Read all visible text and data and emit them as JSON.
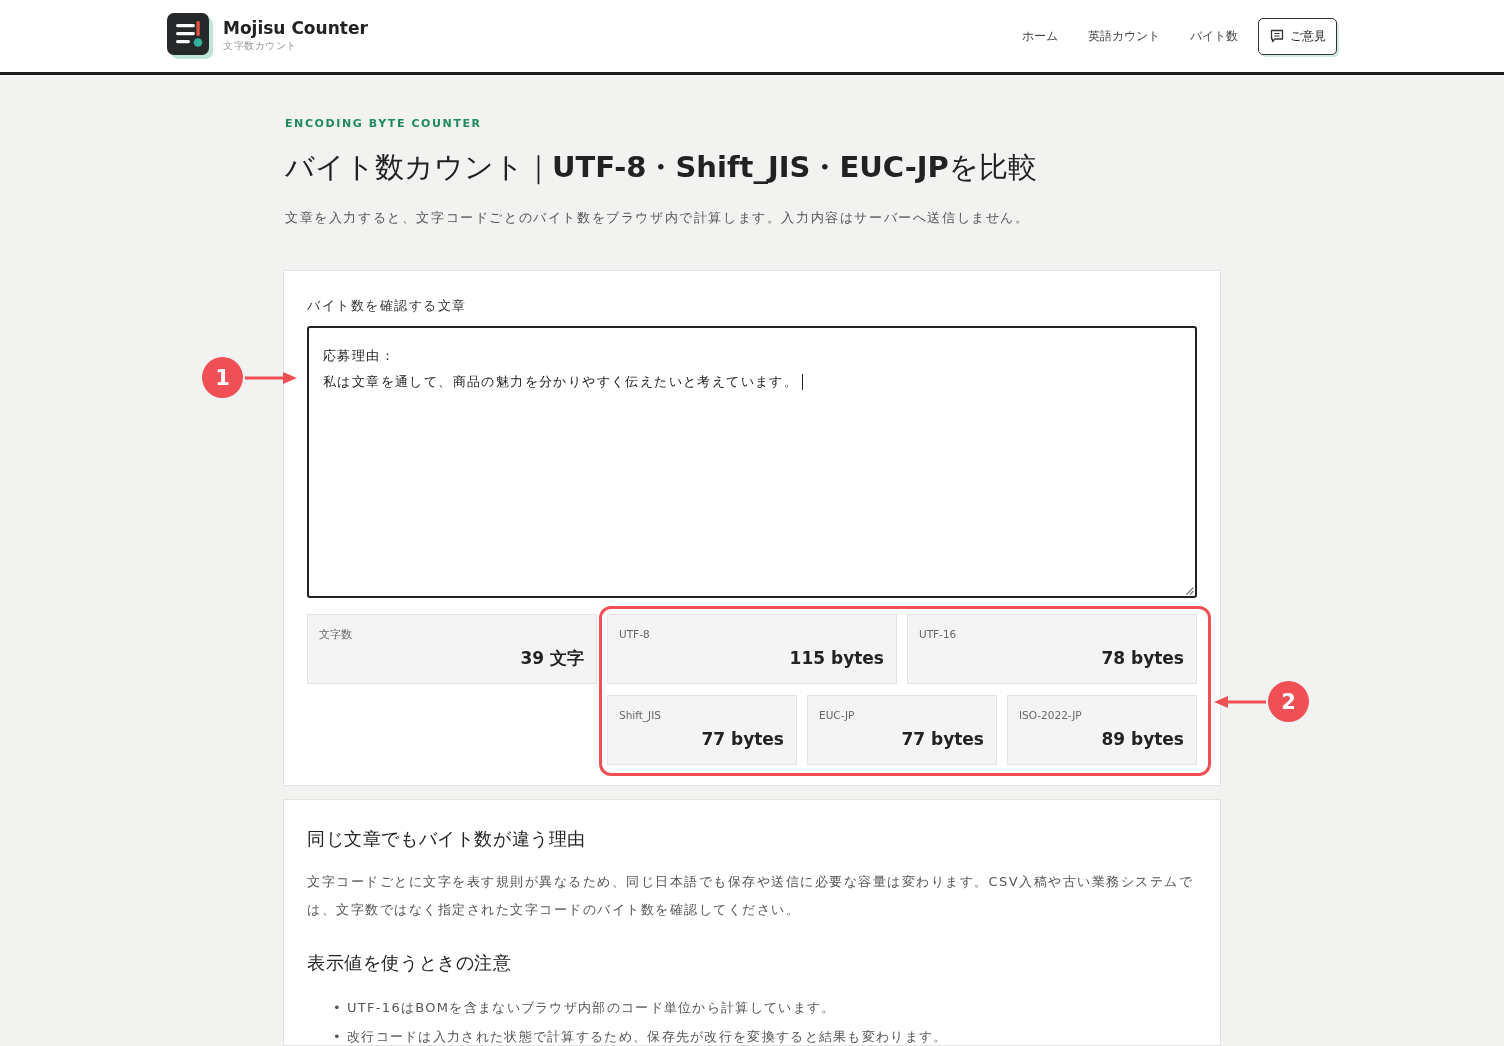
{
  "header": {
    "logo_title": "Mojisu Counter",
    "logo_subtitle": "文字数カウント",
    "nav": [
      {
        "label": "ホーム"
      },
      {
        "label": "英語カウント"
      },
      {
        "label": "バイト数"
      }
    ],
    "feedback_button": "ご意見"
  },
  "hero": {
    "eyebrow": "ENCODING BYTE COUNTER",
    "title": "バイト数カウント｜**UTF-8・Shift_JIS・EUC-JP**を比較",
    "description": "文章を入力すると、文字コードごとのバイト数をブラウザ内で計算します。入力内容はサーバーへ送信しません。"
  },
  "counter": {
    "label": "バイト数を確認する文章",
    "lines": [
      "応募理由：",
      "私は文章を通して、商品の魅力を分かりやすく伝えたいと考えています。"
    ],
    "focused": true,
    "character_count": {
      "label": "文字数",
      "value": "39 文字"
    },
    "encodings": [
      {
        "label": "UTF-8",
        "value": "115 bytes"
      },
      {
        "label": "UTF-16",
        "value": "78 bytes"
      },
      {
        "label": "Shift_JIS",
        "value": "77 bytes"
      },
      {
        "label": "EUC-JP",
        "value": "77 bytes"
      },
      {
        "label": "ISO-2022-JP",
        "value": "89 bytes"
      }
    ]
  },
  "annotations": [
    {
      "label": "1"
    },
    {
      "label": "2"
    }
  ],
  "info": {
    "sections": [
      {
        "heading": "同じ文章でもバイト数が違う理由",
        "paragraph": "文字コードごとに文字を表す規則が異なるため、同じ日本語でも保存や送信に必要な容量は変わります。CSV入稿や古い業務システムでは、文字数ではなく指定された文字コードのバイト数を確認してください。"
      },
      {
        "heading": "表示値を使うときの注意",
        "items": [
          {
            "marker": "•",
            "text": "UTF-16はBOMを含まないブラウザ内部のコード単位から計算しています。"
          },
          {
            "marker": "•",
            "text": "改行コードは入力された状態で計算するため、保存先が改行を変換すると結果も変わります。"
          }
        ]
      }
    ]
  }
}
